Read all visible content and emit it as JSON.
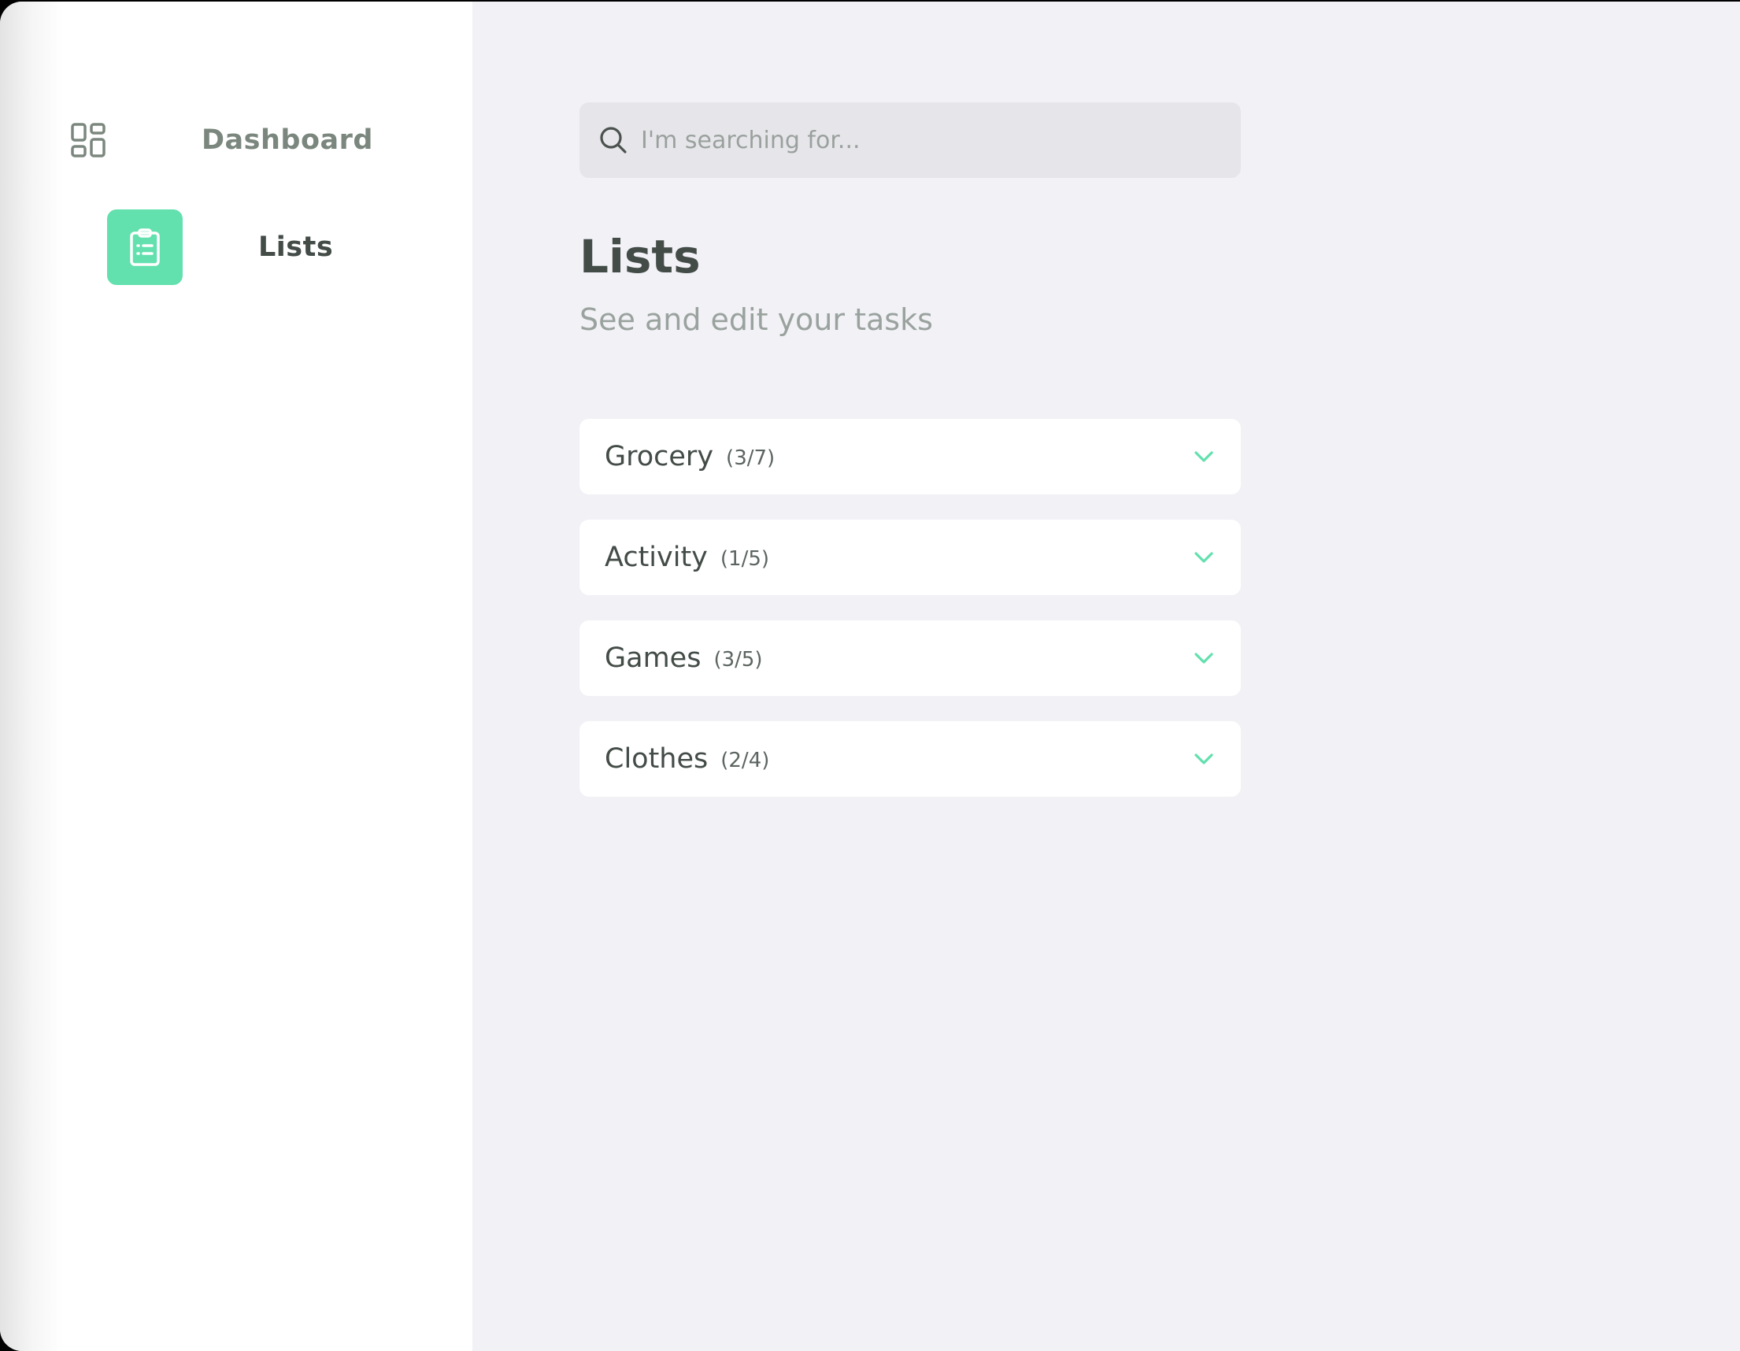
{
  "sidebar": {
    "items": [
      {
        "label": "Dashboard",
        "icon": "dashboard-grid-icon",
        "active": false
      },
      {
        "label": "Lists",
        "icon": "clipboard-list-icon",
        "active": true
      }
    ]
  },
  "search": {
    "placeholder": "I'm searching for...",
    "value": ""
  },
  "header": {
    "title": "Lists",
    "subtitle": "See and edit your tasks"
  },
  "lists": [
    {
      "name": "Grocery",
      "count": "(3/7)"
    },
    {
      "name": "Activity",
      "count": "(1/5)"
    },
    {
      "name": "Games",
      "count": "(3/5)"
    },
    {
      "name": "Clothes",
      "count": "(2/4)"
    }
  ],
  "colors": {
    "accent": "#62e0ae",
    "background": "#f1f1f6",
    "text_dark": "#434c47",
    "text_muted": "#9aa29e"
  }
}
